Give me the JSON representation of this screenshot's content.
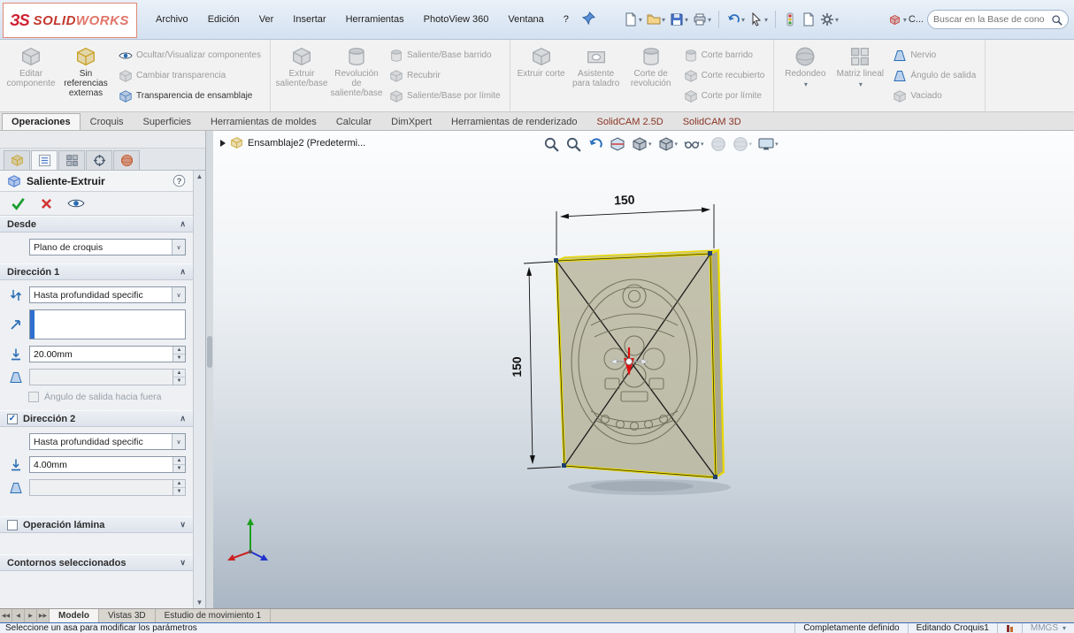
{
  "icons": {
    "logo_glyph": "ЗS",
    "check": "✓",
    "cross": "✗",
    "question": "?",
    "chev_up": "∧",
    "chev_down": "∨",
    "caret_down": "▾",
    "spin_up": "▲",
    "spin_down": "▼",
    "scroll_first": "◀◀",
    "scroll_prev": "◀",
    "scroll_next": "▶",
    "scroll_last": "▶▶"
  },
  "titlebar": {
    "logo_part1": "SOLID",
    "logo_part2": "WORKS",
    "menus": [
      "Archivo",
      "Edición",
      "Ver",
      "Insertar",
      "Herramientas",
      "PhotoView 360",
      "Ventana",
      "?"
    ],
    "search_scope": "C...",
    "search_placeholder": "Buscar en la Base de cono"
  },
  "ribbon": {
    "groups": [
      {
        "big": [
          {
            "label": "Editar componente",
            "enabled": false
          },
          {
            "label": "Sin referencias externas",
            "enabled": true
          }
        ],
        "small": [
          {
            "label": "Ocultar/Visualizar componentes",
            "enabled": false
          },
          {
            "label": "Cambiar transparencia",
            "enabled": false
          },
          {
            "label": "Transparencia de ensamblaje",
            "enabled": true
          }
        ]
      },
      {
        "big": [
          {
            "label": "Extruir saliente/base",
            "enabled": false
          },
          {
            "label": "Revolución de saliente/base",
            "enabled": false
          }
        ],
        "small": [
          {
            "label": "Saliente/Base barrido",
            "enabled": false
          },
          {
            "label": "Recubrir",
            "enabled": false
          },
          {
            "label": "Saliente/Base por límite",
            "enabled": false
          }
        ]
      },
      {
        "big": [
          {
            "label": "Extruir corte",
            "enabled": false
          },
          {
            "label": "Asistente para taladro",
            "enabled": false
          },
          {
            "label": "Corte de revolución",
            "enabled": false
          }
        ],
        "small": [
          {
            "label": "Corte barrido",
            "enabled": false
          },
          {
            "label": "Corte recubierto",
            "enabled": false
          },
          {
            "label": "Corte por límite",
            "enabled": false
          }
        ]
      },
      {
        "big": [
          {
            "label": "Redondeo",
            "enabled": false
          },
          {
            "label": "Matriz lineal",
            "enabled": false
          }
        ],
        "small": [
          {
            "label": "Nervio",
            "enabled": false
          },
          {
            "label": "Ángulo de salida",
            "enabled": false
          },
          {
            "label": "Vaciado",
            "enabled": false
          }
        ]
      }
    ]
  },
  "command_tabs": [
    "Operaciones",
    "Croquis",
    "Superficies",
    "Herramientas de moldes",
    "Calcular",
    "DimXpert",
    "Herramientas de renderizado",
    "SolidCAM 2.5D",
    "SolidCAM 3D"
  ],
  "property_manager": {
    "title": "Saliente-Extruir",
    "desde": {
      "header": "Desde",
      "plane": "Plano de croquis"
    },
    "direccion1": {
      "header": "Dirección 1",
      "end_condition": "Hasta profundidad specific",
      "depth": "20.00mm",
      "draft": "",
      "draft_outward_label": "Ángulo de salida hacia fuera"
    },
    "direccion2": {
      "header": "Dirección 2",
      "end_condition": "Hasta profundidad specific",
      "depth": "4.00mm",
      "draft": ""
    },
    "lamina": {
      "header": "Operación lámina"
    },
    "contornos": {
      "header": "Contornos seleccionados"
    }
  },
  "viewport": {
    "breadcrumb": "Ensamblaje2  (Predetermi...",
    "dim_width": "150",
    "dim_height": "150"
  },
  "bottom_tabs": [
    "Modelo",
    "Vistas 3D",
    "Estudio de movimiento 1"
  ],
  "status_bar": {
    "message": "Seleccione un asa para modificar los parámetros",
    "state": "Completamente definido",
    "editing": "Editando Croquis1",
    "units": "MMGS"
  }
}
